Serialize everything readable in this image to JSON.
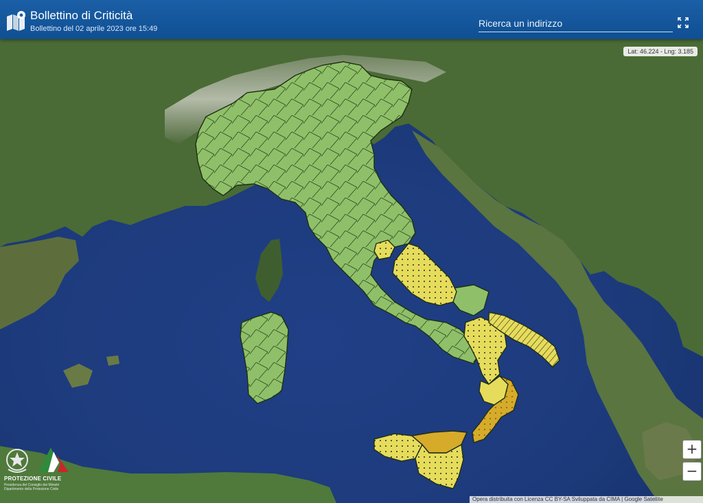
{
  "header": {
    "title": "Bollettino di Criticità",
    "subtitle": "Bollettino del 02 aprile 2023 ore 15:49",
    "logo_icon": "map-pin-icon",
    "fullscreen_icon": "fullscreen-icon"
  },
  "search": {
    "placeholder": "Ricerca un indirizzo"
  },
  "coords": {
    "text": "Lat: 46.224 - Lng: 3.185"
  },
  "zoom": {
    "in_label": "+",
    "out_label": "−"
  },
  "attribution": {
    "text": "Opera distribuita con Licenza CC BY-SA Sviluppata da CIMA | Google Satellite"
  },
  "brand": {
    "name": "PROTEZIONE CIVILE",
    "line1": "Presidenza del Consiglio dei Ministri",
    "line2": "Dipartimento della Protezione Civile"
  },
  "legend_colors": {
    "green": "#8fc069",
    "yellow": "#e6dc5c",
    "orange": "#d7ab2a"
  }
}
